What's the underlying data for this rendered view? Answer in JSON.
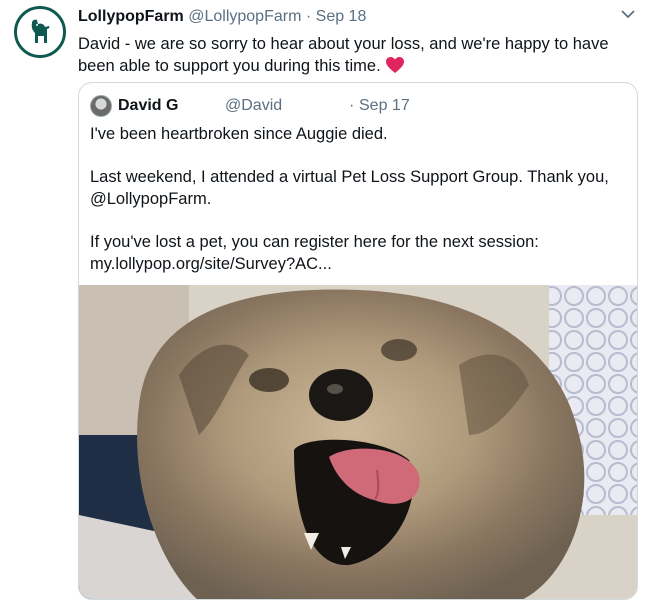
{
  "tweet": {
    "author_name": "LollypopFarm",
    "author_handle": "@LollypopFarm",
    "separator": "·",
    "date": "Sep 18",
    "text": "David - we are so sorry to hear about your loss, and we're happy to have been able to support you during this time.",
    "emoji_icon": "red-heart-icon",
    "avatar_icon": "dog-logo-icon",
    "menu_icon": "chevron-down-icon"
  },
  "quoted": {
    "author_name": "David G",
    "author_handle": "@David",
    "separator": "·",
    "date": "Sep 17",
    "paragraphs": [
      "I've been heartbroken since Auggie died.",
      "Last weekend, I attended a virtual Pet Loss Support Group. Thank you, @LollypopFarm.",
      "If you've lost a pet, you can register here for the next session: my.lollypop.org/site/Survey?AC..."
    ],
    "image_icon": "dog-photo"
  },
  "colors": {
    "brand_green": "#0f5a50",
    "muted": "#5b7083",
    "border": "#cfd9de",
    "heart": "#e0245e"
  }
}
